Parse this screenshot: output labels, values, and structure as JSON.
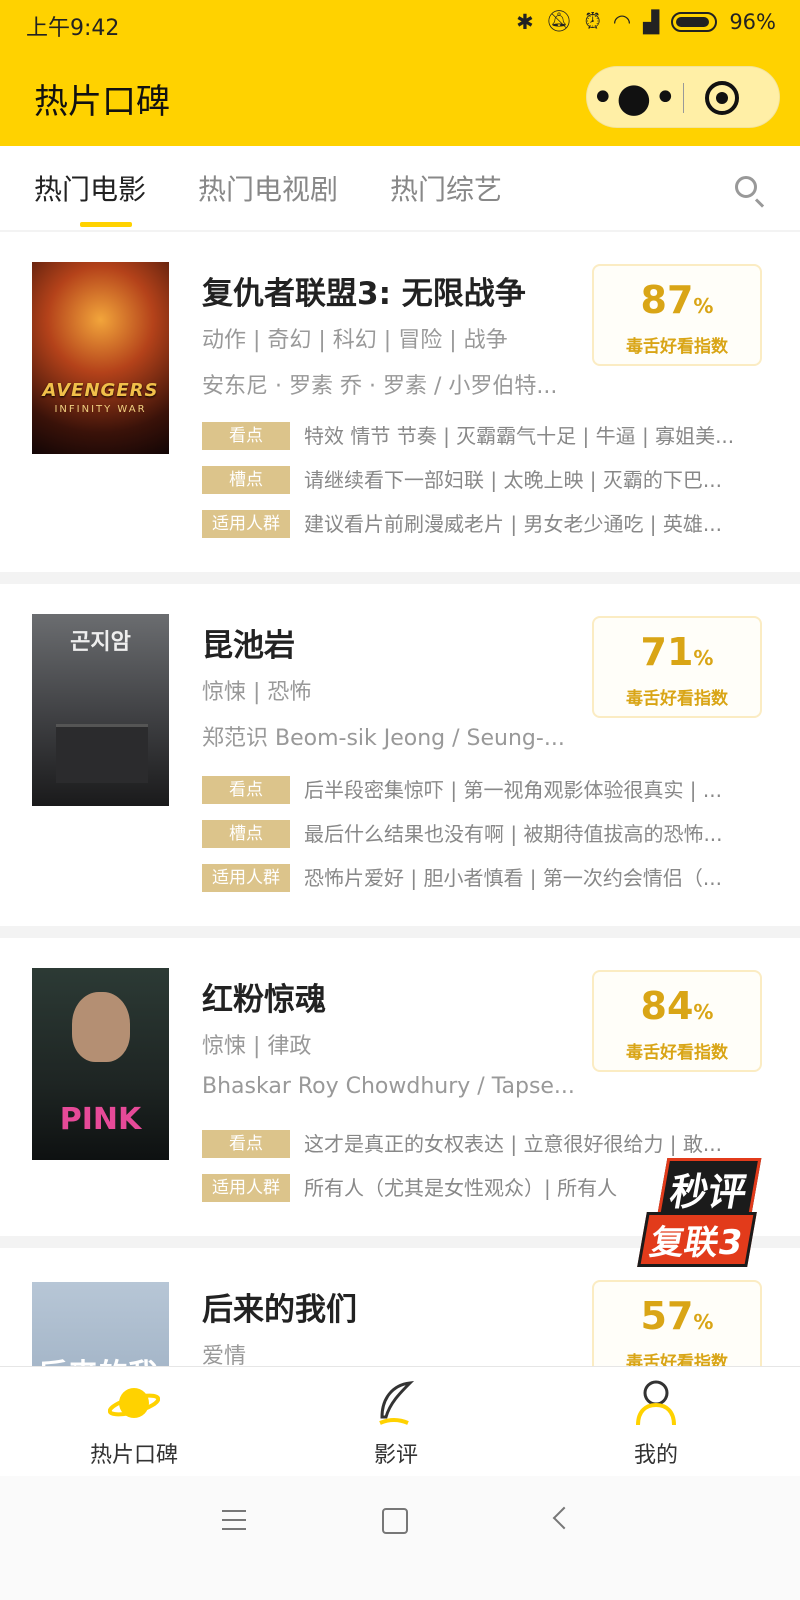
{
  "status_bar": {
    "time": "上午9:42",
    "battery": "96%",
    "icons": [
      "bluetooth-icon",
      "mute-icon",
      "alarm-icon",
      "wifi-icon",
      "signal-icon",
      "battery-icon"
    ]
  },
  "header": {
    "title": "热片口碑",
    "more_glyph": "•●•"
  },
  "tabs": [
    {
      "label": "热门电影",
      "active": true
    },
    {
      "label": "热门电视剧",
      "active": false
    },
    {
      "label": "热门综艺",
      "active": false
    }
  ],
  "score_label": "毒舌好看指数",
  "tag_labels": {
    "highlights": "看点",
    "complaints": "槽点",
    "audience": "适用人群"
  },
  "movies": [
    {
      "title": "复仇者联盟3: 无限战争",
      "genres": "动作 | 奇幻 | 科幻 | 冒险 | 战争",
      "cast": "安东尼 · 罗素 乔 · 罗素 / 小罗伯特...",
      "score": "87",
      "poster_text": "AVENGERS",
      "poster_sub": "INFINITY WAR",
      "highlights": "特效 情节 节奏 | 灭霸霸气十足 | 牛逼 | 寡姐美...",
      "complaints": "请继续看下一部妇联 | 太晚上映 | 灭霸的下巴...",
      "audience": "建议看片前刷漫威老片 | 男女老少通吃 | 英雄..."
    },
    {
      "title": "昆池岩",
      "genres": "惊悚 | 恐怖",
      "cast": "郑范识 Beom-sik Jeong / Seung-...",
      "score": "71",
      "poster_text": "곤지암",
      "highlights": "后半段密集惊吓 | 第一视角观影体验很真实 | ...",
      "complaints": "最后什么结果也没有啊 | 被期待值拔高的恐怖...",
      "audience": "恐怖片爱好 | 胆小者慎看 | 第一次约会情侣（..."
    },
    {
      "title": "红粉惊魂",
      "genres": "惊悚 | 律政",
      "cast": "Bhaskar Roy Chowdhury / Tapse...",
      "score": "84",
      "poster_text": "PINK",
      "highlights": "这才是真正的女权表达 | 立意很好很给力 | 敢...",
      "audience": "所有人（尤其是女性观众）| 所有人"
    },
    {
      "title": "后来的我们",
      "genres": "爱情",
      "score": "57",
      "poster_text": "后来的我"
    }
  ],
  "sticker": {
    "line1": "秒评",
    "line2": "复联3"
  },
  "bottom_nav": [
    {
      "label": "热片口碑",
      "icon": "planet-icon",
      "active": true
    },
    {
      "label": "影评",
      "icon": "feather-icon",
      "active": false
    },
    {
      "label": "我的",
      "icon": "person-icon",
      "active": false
    }
  ]
}
